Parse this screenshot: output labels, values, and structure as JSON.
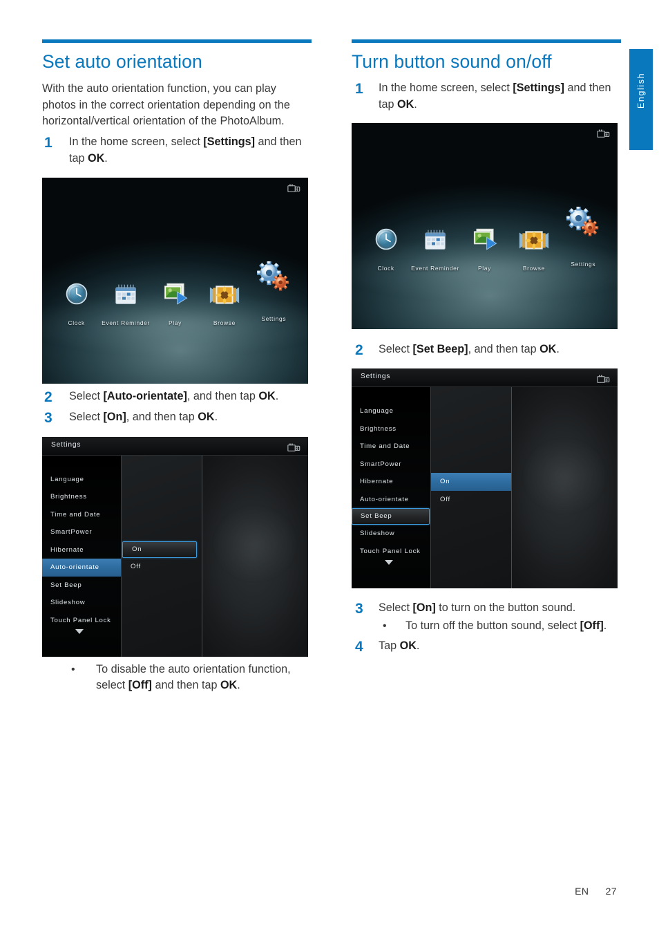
{
  "page": {
    "language_tab": "English",
    "footer": {
      "lang_code": "EN",
      "page_number": "27"
    },
    "accent_color": "#0a78bd"
  },
  "left_column": {
    "title": "Set auto orientation",
    "intro": "With the auto orientation function, you can play photos in the correct orientation depending on the horizontal/vertical orientation of the PhotoAlbum.",
    "steps": [
      {
        "num": "1",
        "text_html": "In the home screen, select <b>[Settings]</b> and then tap <span class=\"ok\">OK</span>."
      },
      {
        "num": "2",
        "text_html": "Select <b>[Auto-orientate]</b>, and then tap <span class=\"ok\">OK</span>."
      },
      {
        "num": "3",
        "text_html": "Select <b>[On]</b>, and then tap <span class=\"ok\">OK</span>."
      }
    ],
    "note_html": "To disable the auto orientation function, select <b>[Off]</b> and then tap <span class=\"ok\">OK</span>.",
    "bullet_char": "•"
  },
  "right_column": {
    "title": "Turn button sound on/off",
    "steps": [
      {
        "num": "1",
        "text_html": "In the home screen, select <b>[Settings]</b> and then tap <span class=\"ok\">OK</span>."
      },
      {
        "num": "2",
        "text_html": "Select <b>[Set Beep]</b>, and then tap <span class=\"ok\">OK</span>."
      },
      {
        "num": "3",
        "text_html": "Select <b>[On]</b> to turn on the button sound."
      },
      {
        "num": "4",
        "text_html": "Tap <span class=\"ok\">OK</span>."
      }
    ],
    "sub_note_html": "To turn off the button sound, select <b>[Off]</b>.",
    "bullet_char": "•"
  },
  "home_screen": {
    "status_icon": "sd-card-battery-icon",
    "apps": [
      {
        "label": "Clock",
        "icon": "clock-icon"
      },
      {
        "label": "Event Reminder",
        "icon": "calendar-icon"
      },
      {
        "label": "Play",
        "icon": "play-photos-icon"
      },
      {
        "label": "Browse",
        "icon": "browse-photos-icon"
      },
      {
        "label": "Settings",
        "icon": "gears-icon"
      }
    ]
  },
  "settings_screen_left": {
    "title": "Settings",
    "status_icon": "sd-card-battery-icon",
    "menu_items": [
      {
        "label": "Language",
        "state": "normal"
      },
      {
        "label": "Brightness",
        "state": "normal"
      },
      {
        "label": "Time and Date",
        "state": "normal"
      },
      {
        "label": "SmartPower",
        "state": "normal"
      },
      {
        "label": "Hibernate",
        "state": "normal"
      },
      {
        "label": "Auto-orientate",
        "state": "selected-fill"
      },
      {
        "label": "Set Beep",
        "state": "normal"
      },
      {
        "label": "Slideshow",
        "state": "normal"
      },
      {
        "label": "Touch Panel Lock",
        "state": "normal"
      }
    ],
    "scroll_indicator": "chevron-down-icon",
    "options": [
      {
        "label": "On",
        "state": "selected-focus"
      },
      {
        "label": "Off",
        "state": "normal"
      }
    ]
  },
  "settings_screen_right": {
    "title": "Settings",
    "status_icon": "sd-card-battery-icon",
    "menu_items": [
      {
        "label": "Language",
        "state": "normal"
      },
      {
        "label": "Brightness",
        "state": "normal"
      },
      {
        "label": "Time and Date",
        "state": "normal"
      },
      {
        "label": "SmartPower",
        "state": "normal"
      },
      {
        "label": "Hibernate",
        "state": "normal"
      },
      {
        "label": "Auto-orientate",
        "state": "normal"
      },
      {
        "label": "Set Beep",
        "state": "selected-focus"
      },
      {
        "label": "Slideshow",
        "state": "normal"
      },
      {
        "label": "Touch Panel Lock",
        "state": "normal"
      }
    ],
    "scroll_indicator": "chevron-down-icon",
    "options": [
      {
        "label": "On",
        "state": "selected-fill"
      },
      {
        "label": "Off",
        "state": "normal"
      }
    ]
  }
}
